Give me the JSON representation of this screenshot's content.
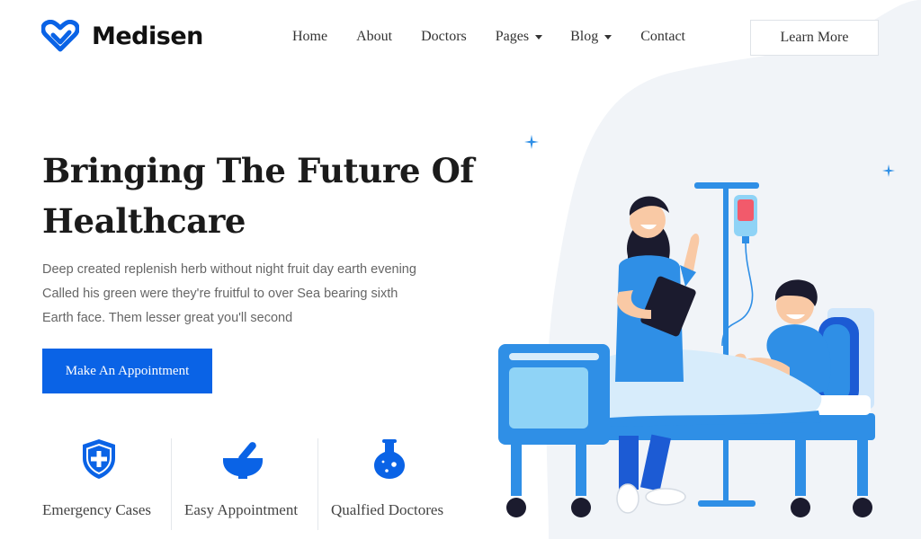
{
  "brand": {
    "name": "Medisen",
    "color": "#0a63e6"
  },
  "nav": {
    "items": [
      {
        "label": "Home",
        "dropdown": false
      },
      {
        "label": "About",
        "dropdown": false
      },
      {
        "label": "Doctors",
        "dropdown": false
      },
      {
        "label": "Pages",
        "dropdown": true
      },
      {
        "label": "Blog",
        "dropdown": true
      },
      {
        "label": "Contact",
        "dropdown": false
      }
    ],
    "cta_label": "Learn More"
  },
  "hero": {
    "title_line1": "Bringing The Future Of",
    "title_line2": "Healthcare",
    "desc_line1": "Deep created replenish herb without night fruit day earth evening",
    "desc_line2": "Called his green were they're fruitful to over Sea bearing sixth",
    "desc_line3": "Earth face. Them lesser great you'll second",
    "button_label": "Make An Appointment"
  },
  "features": [
    {
      "label": "Emergency Cases",
      "icon": "shield-plus-icon"
    },
    {
      "label": "Easy Appointment",
      "icon": "mortar-pestle-icon"
    },
    {
      "label": "Qualfied Doctores",
      "icon": "flask-icon"
    }
  ],
  "colors": {
    "accent": "#0a63e6",
    "illustration_blue": "#2f8fe6",
    "light_bg": "#f1f4f8"
  }
}
